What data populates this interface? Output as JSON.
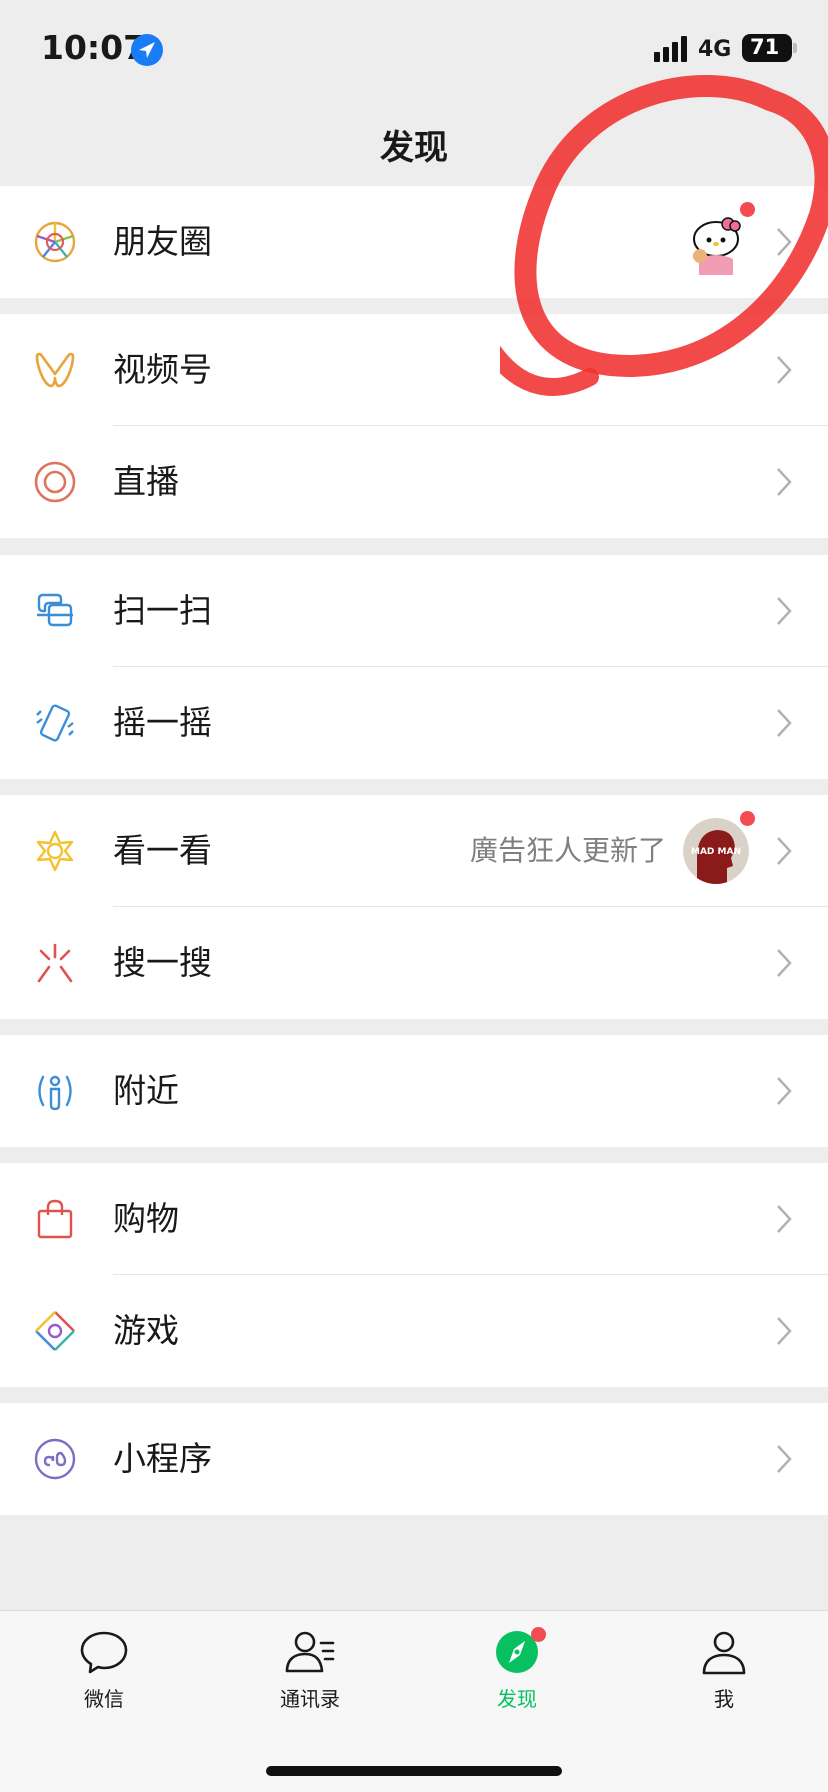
{
  "status_bar": {
    "time": "10:07",
    "network": "4G",
    "battery": "71"
  },
  "nav": {
    "title": "发现"
  },
  "groups": [
    {
      "items": [
        {
          "label": "朋友圈",
          "icon": "moments-icon"
        }
      ]
    },
    {
      "items": [
        {
          "label": "视频号",
          "icon": "channels-icon"
        },
        {
          "label": "直播",
          "icon": "live-icon"
        }
      ]
    },
    {
      "items": [
        {
          "label": "扫一扫",
          "icon": "scan-icon"
        },
        {
          "label": "摇一摇",
          "icon": "shake-icon"
        }
      ]
    },
    {
      "items": [
        {
          "label": "看一看",
          "icon": "top-stories-icon",
          "extra": "廣告狂人更新了"
        },
        {
          "label": "搜一搜",
          "icon": "search-icon"
        }
      ]
    },
    {
      "items": [
        {
          "label": "附近",
          "icon": "nearby-icon"
        }
      ]
    },
    {
      "items": [
        {
          "label": "购物",
          "icon": "shopping-icon"
        },
        {
          "label": "游戏",
          "icon": "games-icon"
        }
      ]
    },
    {
      "items": [
        {
          "label": "小程序",
          "icon": "mini-programs-icon"
        }
      ]
    }
  ],
  "top_stories_avatar_text": "MAD MAN",
  "tabbar": [
    {
      "label": "微信",
      "icon": "chat-icon"
    },
    {
      "label": "通讯录",
      "icon": "contacts-icon"
    },
    {
      "label": "发现",
      "icon": "discover-icon",
      "active": true
    },
    {
      "label": "我",
      "icon": "me-icon"
    }
  ],
  "colors": {
    "accent": "#07c160",
    "badge": "#f34b52",
    "annotation": "#f03030"
  }
}
